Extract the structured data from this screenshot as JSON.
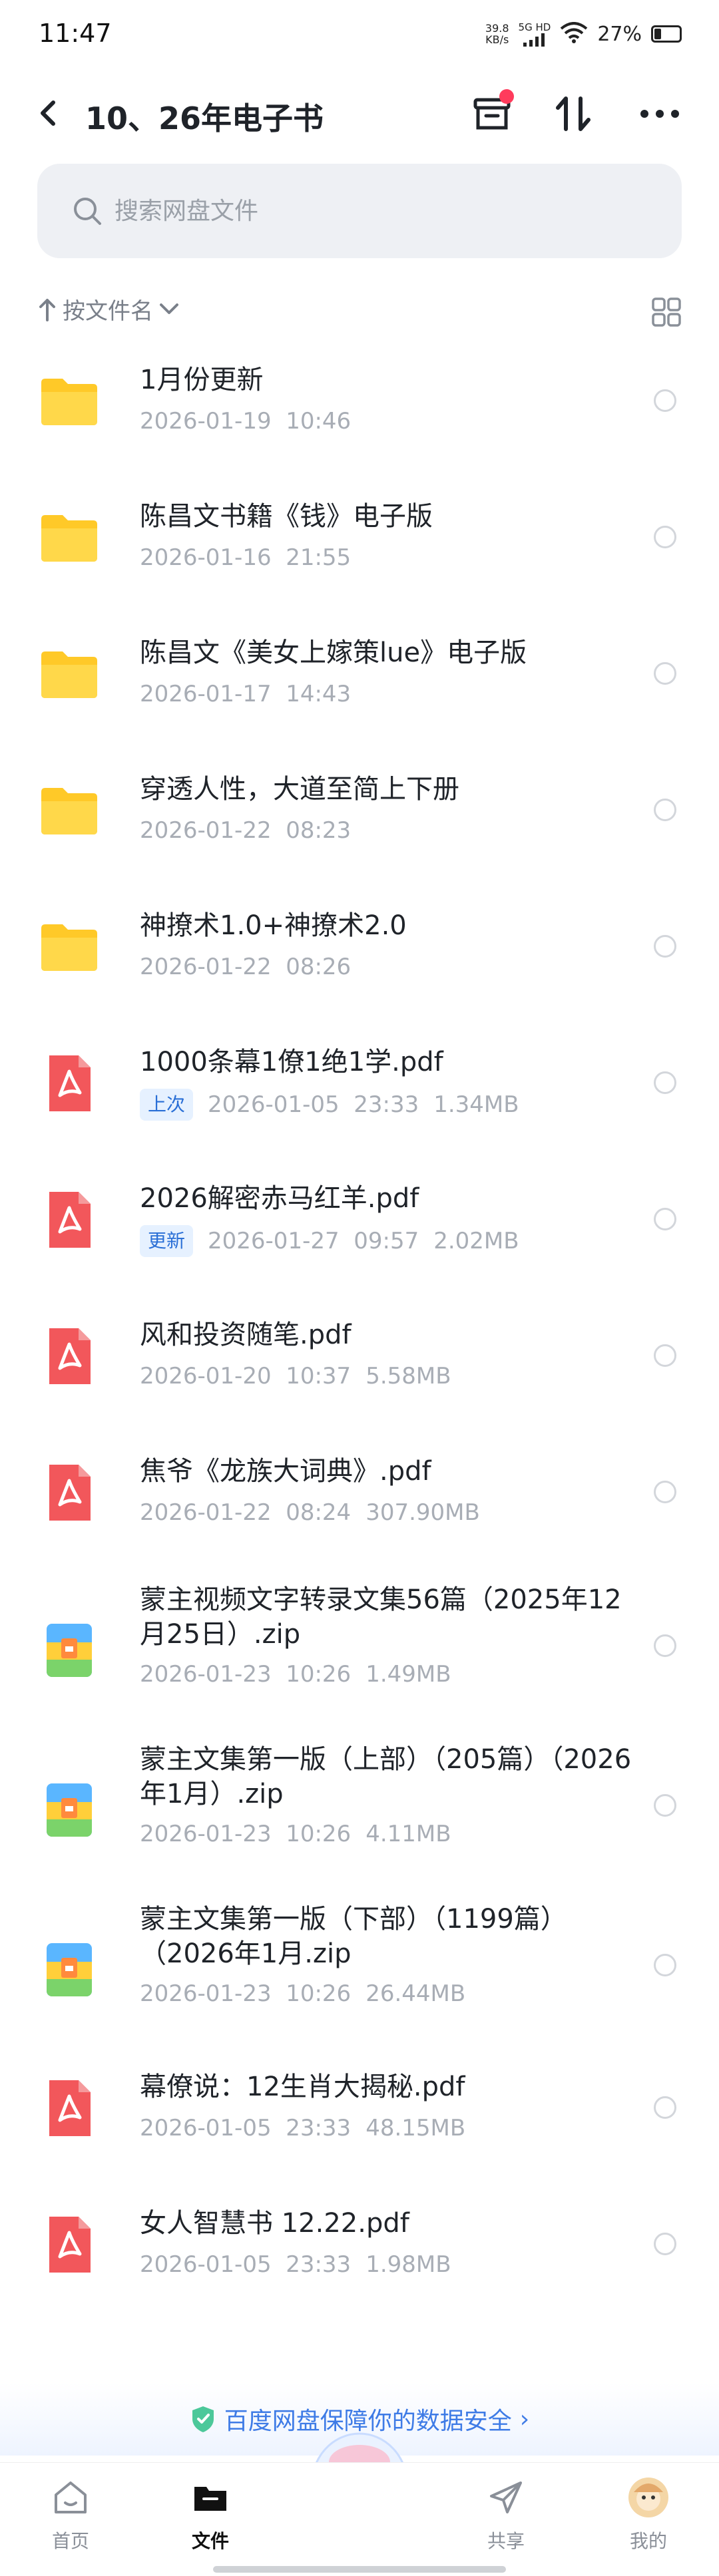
{
  "status_bar": {
    "time": "11:47",
    "net_speed_value": "39.8",
    "net_speed_unit": "KB/s",
    "network": "5G HD",
    "battery": "27%",
    "battery_level": 0.27
  },
  "header": {
    "title": "10、26年电子书"
  },
  "search": {
    "placeholder": "搜索网盘文件"
  },
  "sort": {
    "label": "按文件名"
  },
  "files": [
    {
      "type": "folder",
      "name": "1月份更新",
      "date": "2026-01-19  10:46",
      "size": "",
      "tag": ""
    },
    {
      "type": "folder",
      "name": "陈昌文书籍《钱》电子版",
      "date": "2026-01-16  21:55",
      "size": "",
      "tag": ""
    },
    {
      "type": "folder",
      "name": "陈昌文《美女上嫁策lue》电子版",
      "date": "2026-01-17  14:43",
      "size": "",
      "tag": ""
    },
    {
      "type": "folder",
      "name": "穿透人性，大道至简上下册",
      "date": "2026-01-22  08:23",
      "size": "",
      "tag": ""
    },
    {
      "type": "folder",
      "name": "神撩术1.0+神撩术2.0",
      "date": "2026-01-22  08:26",
      "size": "",
      "tag": ""
    },
    {
      "type": "pdf",
      "name": "1000条幕1僚1绝1学.pdf",
      "date": "2026-01-05  23:33",
      "size": "1.34MB",
      "tag": "上次"
    },
    {
      "type": "pdf",
      "name": "2026解密赤马红羊.pdf",
      "date": "2026-01-27  09:57",
      "size": "2.02MB",
      "tag": "更新"
    },
    {
      "type": "pdf",
      "name": "风和投资随笔.pdf",
      "date": "2026-01-20  10:37",
      "size": "5.58MB",
      "tag": ""
    },
    {
      "type": "pdf",
      "name": "焦爷《龙族大词典》.pdf",
      "date": "2026-01-22  08:24",
      "size": "307.90MB",
      "tag": ""
    },
    {
      "type": "zip",
      "name": "蒙主视频文字转录文集56篇（2025年12月25日）.zip",
      "date": "2026-01-23  10:26",
      "size": "1.49MB",
      "tag": ""
    },
    {
      "type": "zip",
      "name": "蒙主文集第一版（上部）（205篇）（2026年1月）.zip",
      "date": "2026-01-23  10:26",
      "size": "4.11MB",
      "tag": ""
    },
    {
      "type": "zip",
      "name": "蒙主文集第一版（下部）（1199篇）（2026年1月.zip",
      "date": "2026-01-23  10:26",
      "size": "26.44MB",
      "tag": ""
    },
    {
      "type": "pdf",
      "name": "幕僚说：12生肖大揭秘.pdf",
      "date": "2026-01-05  23:33",
      "size": "48.15MB",
      "tag": ""
    },
    {
      "type": "pdf",
      "name": "女人智慧书 12.22.pdf",
      "date": "2026-01-05  23:33",
      "size": "1.98MB",
      "tag": ""
    }
  ],
  "banner": {
    "text": "百度网盘保障你的数据安全",
    "arrow": "›"
  },
  "nav": {
    "home": "首页",
    "files": "文件",
    "share": "共享",
    "mine": "我的"
  },
  "colors": {
    "accent": "#3e7be6",
    "folder": "#ffcd2e",
    "pdf": "#f2575b",
    "tag_bg": "#e6f1ff",
    "tag_text": "#2a6fd6"
  }
}
